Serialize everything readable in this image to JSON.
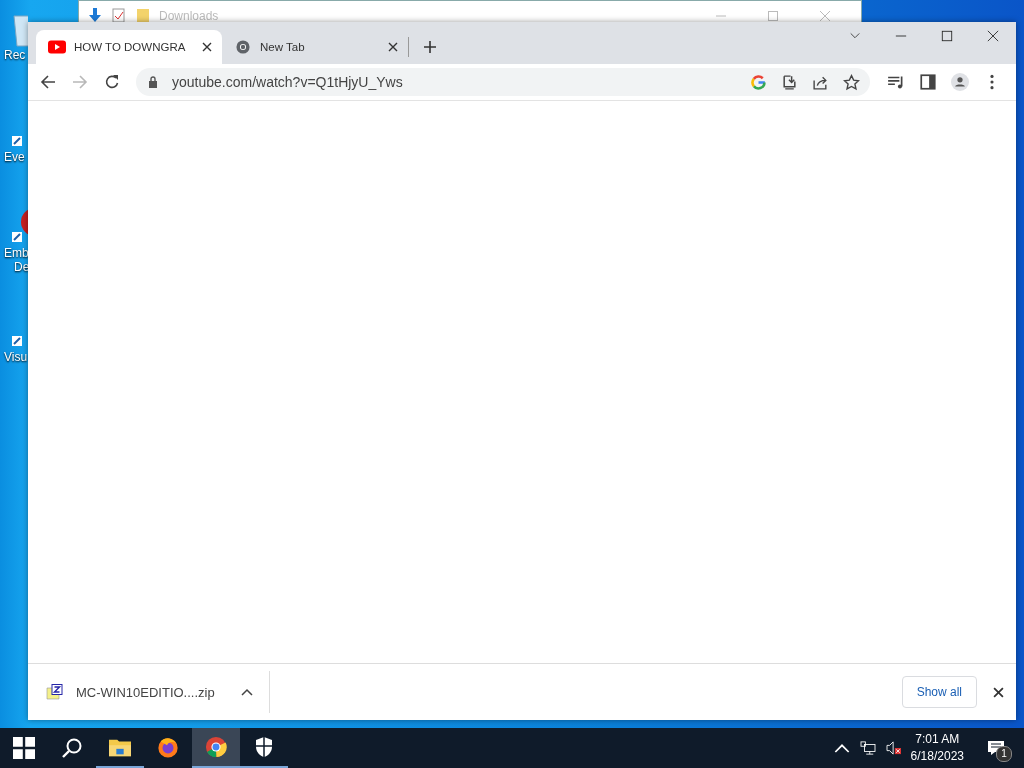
{
  "desktop_icons": [
    {
      "lines": [
        "Rec"
      ],
      "kind": "recycle"
    },
    {
      "lines": [
        "Eve"
      ],
      "kind": "app"
    },
    {
      "lines": [
        "Emb",
        "De"
      ],
      "kind": "red"
    },
    {
      "lines": [
        "Visu"
      ],
      "kind": "purple"
    }
  ],
  "background_window": {
    "title": "Downloads"
  },
  "browser": {
    "tabs": [
      {
        "title": "HOW TO DOWNGRA",
        "selected": true,
        "kind": "youtube"
      },
      {
        "title": "New Tab",
        "selected": false,
        "kind": "chrome"
      }
    ],
    "forward_disabled": true,
    "address": "youtube.com/watch?v=Q1tHjyU_Yws",
    "download_bar": {
      "file": "MC-WIN10EDITIO....zip",
      "button": "Show all"
    }
  },
  "taskbar": {
    "apps": [
      {
        "kind": "explorer",
        "selected": false,
        "running": true
      },
      {
        "kind": "firefox",
        "selected": false,
        "running": false
      },
      {
        "kind": "chrome",
        "selected": true,
        "running": true
      },
      {
        "kind": "security",
        "selected": false,
        "running": true
      }
    ],
    "time": "7:01 AM",
    "date": "6/18/2023",
    "notification_count": "1"
  }
}
